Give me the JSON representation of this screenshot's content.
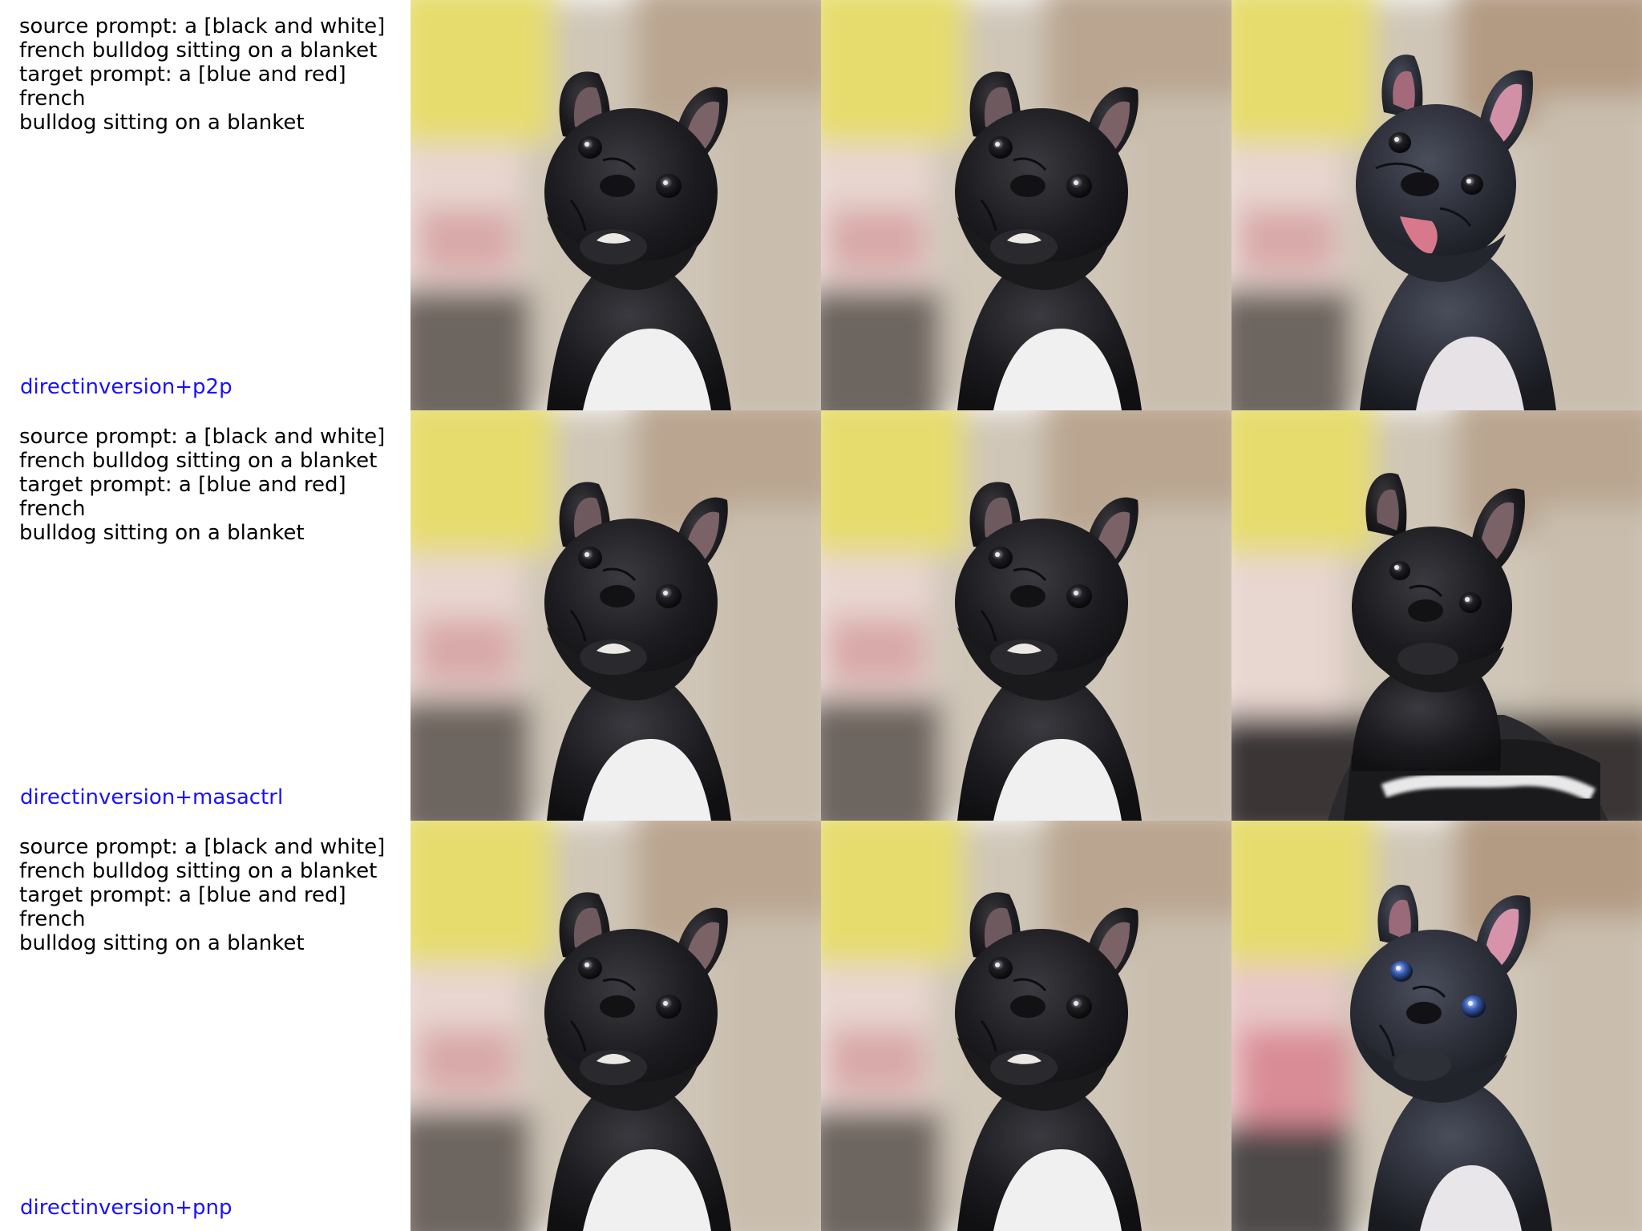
{
  "rows": [
    {
      "prompt": "source prompt: a [black and white]\nfrench bulldog sitting on a blanket\ntarget prompt: a [blue and red] french\nbulldog sitting on a blanket",
      "method": "directinversion+p2p",
      "images": [
        {
          "icon": "french-bulldog-source-image"
        },
        {
          "icon": "french-bulldog-reconstruction-image"
        },
        {
          "icon": "french-bulldog-edited-image"
        }
      ]
    },
    {
      "prompt": "source prompt: a [black and white]\nfrench bulldog sitting on a blanket\ntarget prompt: a [blue and red] french\nbulldog sitting on a blanket",
      "method": "directinversion+masactrl",
      "images": [
        {
          "icon": "french-bulldog-source-image"
        },
        {
          "icon": "french-bulldog-reconstruction-image"
        },
        {
          "icon": "french-bulldog-edited-image"
        }
      ]
    },
    {
      "prompt": "source prompt: a [black and white]\nfrench bulldog sitting on a blanket\ntarget prompt: a [blue and red] french\nbulldog sitting on a blanket",
      "method": "directinversion+pnp",
      "images": [
        {
          "icon": "french-bulldog-source-image"
        },
        {
          "icon": "french-bulldog-reconstruction-image"
        },
        {
          "icon": "french-bulldog-edited-image"
        }
      ]
    }
  ],
  "colors": {
    "method_label": "#1a10ff",
    "dog_fur": "#1e1e22",
    "dog_chest": "#f2f2f2",
    "background_blur_yellow": "#e6dc6e",
    "background_blur_beige": "#cfc6b8",
    "ear_inner_pink": "#c88a94",
    "tongue_pink": "#d7788c",
    "eye_blue": "#3b5fb8"
  }
}
